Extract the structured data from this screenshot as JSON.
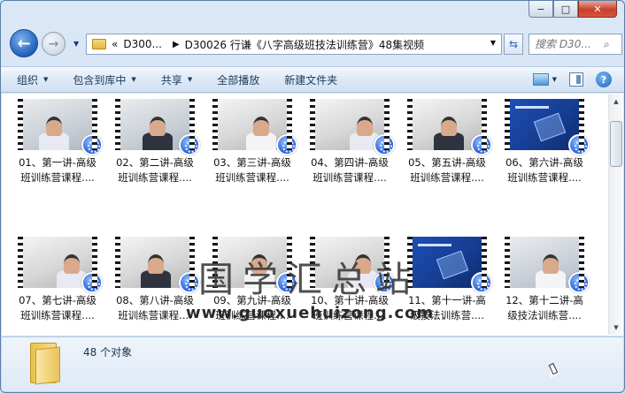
{
  "window": {
    "caption_buttons": {
      "minimize": "−",
      "maximize": "□",
      "close": "✕"
    }
  },
  "nav": {
    "back_glyph": "←",
    "forward_glyph": "→",
    "breadcrumb": [
      "D300...",
      "D30026 行谦《八字高级班技法训练营》48集视频"
    ],
    "breadcrumb_prefix": "«",
    "search_placeholder": "搜索 D30..."
  },
  "toolbar": {
    "items": [
      "组织",
      "包含到库中",
      "共享",
      "全部播放",
      "新建文件夹"
    ],
    "has_dropdown": [
      true,
      true,
      true,
      false,
      false
    ]
  },
  "files": [
    {
      "line1": "01、第一讲-高级",
      "line2": "班训练营课程....",
      "thumb": "room"
    },
    {
      "line1": "02、第二讲-高级",
      "line2": "班训练营课程....",
      "thumb": "room"
    },
    {
      "line1": "03、第三讲-高级",
      "line2": "班训练营课程....",
      "thumb": "room2"
    },
    {
      "line1": "04、第四讲-高级",
      "line2": "班训练营课程....",
      "thumb": "room2"
    },
    {
      "line1": "05、第五讲-高级",
      "line2": "班训练营课程....",
      "thumb": "room2"
    },
    {
      "line1": "06、第六讲-高级",
      "line2": "班训练营课程....",
      "thumb": "slide"
    },
    {
      "line1": "07、第七讲-高级",
      "line2": "班训练营课程....",
      "thumb": "room2"
    },
    {
      "line1": "08、第八讲-高级",
      "line2": "班训练营课程....",
      "thumb": "room2"
    },
    {
      "line1": "09、第九讲-高级",
      "line2": "班训练营课程....",
      "thumb": "room2"
    },
    {
      "line1": "10、第十讲-高级",
      "line2": "班训练营课程....",
      "thumb": "room2"
    },
    {
      "line1": "11、第十一讲-高",
      "line2": "级技法训练营....",
      "thumb": "slide"
    },
    {
      "line1": "12、第十二讲-高",
      "line2": "级技法训练营....",
      "thumb": "room"
    }
  ],
  "watermark": {
    "title": "国学汇总站",
    "url": "www.guoxuehuizong.com"
  },
  "status": {
    "count_text": "48 个对象"
  }
}
